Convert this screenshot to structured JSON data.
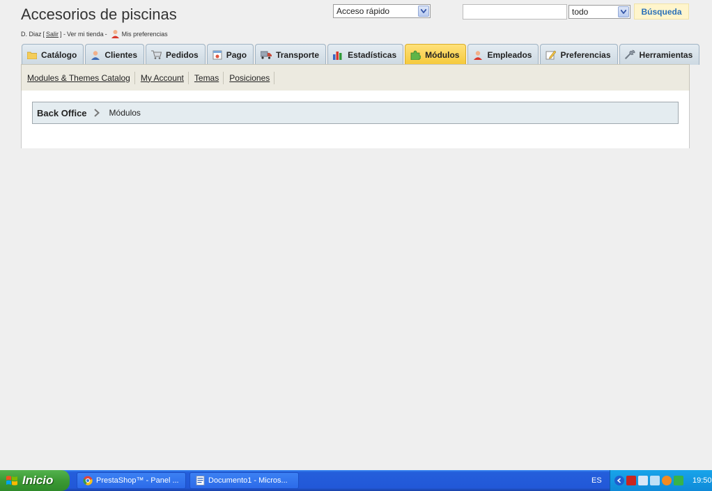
{
  "header": {
    "shop_title": "Accesorios de piscinas",
    "user_name": "D. Diaz",
    "logout_label": "Salir",
    "view_store_label": "Ver mi tienda",
    "preferences_label": "Mis preferencias"
  },
  "quick_access": {
    "selected": "Acceso rápido"
  },
  "search": {
    "value": "",
    "scope_selected": "todo",
    "button_label": "Búsqueda"
  },
  "tabs": [
    {
      "label": "Catálogo",
      "icon": "folder-icon"
    },
    {
      "label": "Clientes",
      "icon": "user-icon"
    },
    {
      "label": "Pedidos",
      "icon": "cart-icon"
    },
    {
      "label": "Pago",
      "icon": "payment-icon"
    },
    {
      "label": "Transporte",
      "icon": "truck-icon"
    },
    {
      "label": "Estadísticas",
      "icon": "chart-icon"
    },
    {
      "label": "Módulos",
      "icon": "puzzle-icon",
      "active": true
    },
    {
      "label": "Empleados",
      "icon": "employee-icon"
    },
    {
      "label": "Preferencias",
      "icon": "preferences-icon"
    },
    {
      "label": "Herramientas",
      "icon": "wrench-icon"
    }
  ],
  "subtabs": [
    "Modules & Themes Catalog",
    "My Account",
    "Temas",
    "Posiciones"
  ],
  "breadcrumb": {
    "root": "Back Office",
    "current": "Módulos"
  },
  "taskbar": {
    "start_label": "Inicio",
    "tasks": [
      "PrestaShop™ - Panel ...",
      "Documento1 - Micros..."
    ],
    "language": "ES",
    "clock": "19:50"
  },
  "colors": {
    "active_tab": "#f5c93a",
    "search_button_text": "#2a70b8",
    "taskbar": "#245edb"
  }
}
